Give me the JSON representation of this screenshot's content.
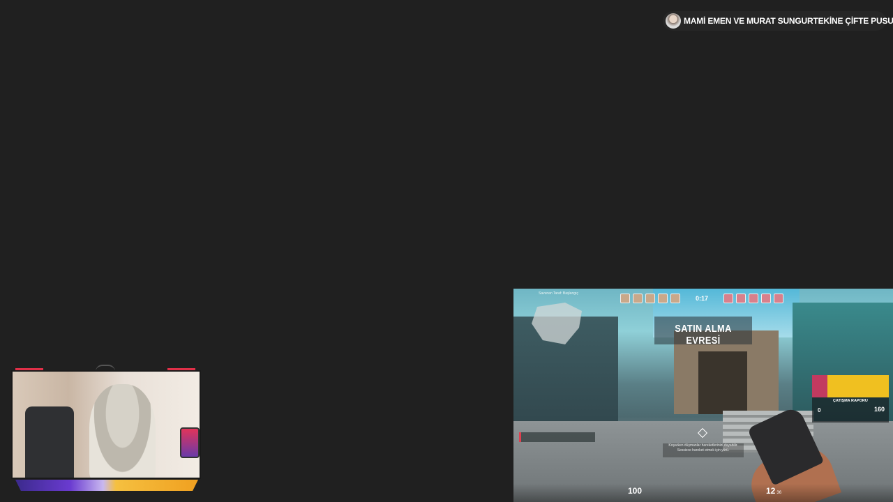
{
  "notification": {
    "title": "MAMİ EMEN VE MURAT SUNGURTEKİNE ÇİFTE PUSU",
    "avatar_icon": "avatar",
    "close_icon": "close-icon"
  },
  "game": {
    "minimap_note": "Savunan Taraf: Başlangıç",
    "timer": "0:17",
    "buy_phase": "SATIN ALMA EVRESİ",
    "hint_line1": "Koşarken düşmanlar hareketlerinizi duyabilir.",
    "hint_line2": "Sessizce hareket etmek için yürü.",
    "report_title": "ÇATIŞMA RAPORU",
    "report_left": "0",
    "report_right": "160",
    "health": "100",
    "ammo": "12",
    "ammo_reserve": "36"
  },
  "colors": {
    "background": "#202020",
    "accent_red": "#e03048",
    "bar_purple": "#6a3bd0",
    "bar_orange": "#f0a020"
  }
}
